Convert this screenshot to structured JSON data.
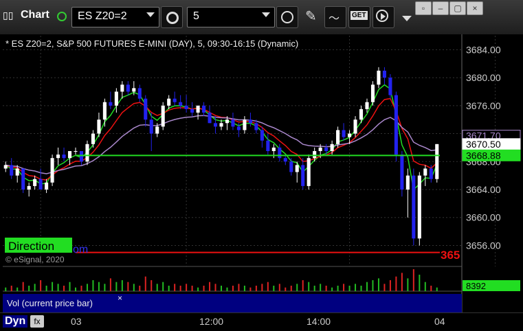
{
  "toolbar": {
    "app_label": "Chart",
    "symbol": "ES Z20=2",
    "interval": "5",
    "get_label": "GET"
  },
  "chart_header": "* ES Z20=2, S&P 500 FUTURES E-MINI (DAY), 5, 09:30-16:15 (Dynamic)",
  "copyright": "© eSignal, 2020",
  "direction_label": "Direction",
  "partial_label_blue": "om",
  "partial_label_red": "365",
  "vol_label": "Vol (current price bar)",
  "vol_close": "×",
  "status": {
    "mode": "Dyn",
    "fx": "fx"
  },
  "colors": {
    "up_candle": "#ffffff",
    "down_candle": "#2222ee",
    "fast_ma": "#22dd22",
    "red_ma": "#ee1111",
    "purple_ma": "#aa88cc",
    "level_green": "#22dd22",
    "level_red": "#ee1111",
    "volume_bar": "#2222aa"
  },
  "chart_data": {
    "type": "candlestick",
    "title": "ES Z20=2, S&P 500 FUTURES E-MINI (DAY), 5, 09:30-16:15 (Dynamic)",
    "ylim": [
      3653,
      3686
    ],
    "y_ticks": [
      "3684.00",
      "3680.00",
      "3676.00",
      "3672.00",
      "3668.00",
      "3664.00",
      "3660.00",
      "3656.00"
    ],
    "x_ticks": [
      {
        "bar": 6,
        "label": "03"
      },
      {
        "bar": 31,
        "label": "12:00"
      },
      {
        "bar": 59,
        "label": "14:00"
      },
      {
        "bar": 84,
        "label": "04"
      }
    ],
    "price_tags": [
      {
        "value": 3671.7,
        "label": "3671.70",
        "style": "purple"
      },
      {
        "value": 3670.5,
        "label": "3670.50",
        "style": "white"
      },
      {
        "value": 3668.88,
        "label": "3668.88",
        "style": "green"
      }
    ],
    "levels": [
      {
        "name": "Direction",
        "value": 3668.88,
        "color": "green"
      },
      {
        "name": "red-level",
        "value": 3655,
        "color": "red"
      }
    ],
    "candles": [
      [
        3667.0,
        3668.0,
        3666.5,
        3667.5
      ],
      [
        3667.5,
        3668.5,
        3665.5,
        3666.0
      ],
      [
        3666.0,
        3667.5,
        3665.0,
        3667.0
      ],
      [
        3667.0,
        3667.0,
        3663.5,
        3664.0
      ],
      [
        3664.0,
        3665.0,
        3663.0,
        3664.5
      ],
      [
        3664.5,
        3666.0,
        3664.0,
        3665.5
      ],
      [
        3665.5,
        3667.0,
        3664.0,
        3664.0
      ],
      [
        3664.0,
        3665.5,
        3663.5,
        3665.0
      ],
      [
        3665.0,
        3669.0,
        3664.5,
        3668.5
      ],
      [
        3668.5,
        3670.0,
        3667.5,
        3669.0
      ],
      [
        3669.0,
        3670.0,
        3668.0,
        3668.5
      ],
      [
        3668.5,
        3669.5,
        3667.5,
        3669.5
      ],
      [
        3669.5,
        3670.0,
        3669.0,
        3669.5
      ],
      [
        3669.5,
        3669.5,
        3667.5,
        3668.0
      ],
      [
        3668.0,
        3671.0,
        3667.5,
        3670.5
      ],
      [
        3670.5,
        3672.5,
        3670.0,
        3672.0
      ],
      [
        3672.0,
        3675.0,
        3671.5,
        3674.0
      ],
      [
        3674.0,
        3677.0,
        3673.0,
        3676.5
      ],
      [
        3676.5,
        3678.0,
        3675.5,
        3676.0
      ],
      [
        3676.0,
        3678.5,
        3675.0,
        3678.0
      ],
      [
        3678.0,
        3679.5,
        3677.0,
        3679.0
      ],
      [
        3679.0,
        3679.5,
        3677.5,
        3678.0
      ],
      [
        3678.0,
        3679.5,
        3677.5,
        3678.5
      ],
      [
        3678.5,
        3679.0,
        3676.5,
        3677.0
      ],
      [
        3677.0,
        3677.5,
        3673.0,
        3674.0
      ],
      [
        3674.0,
        3675.0,
        3669.5,
        3672.0
      ],
      [
        3672.0,
        3673.5,
        3671.5,
        3673.0
      ],
      [
        3673.0,
        3676.5,
        3672.5,
        3676.0
      ],
      [
        3676.0,
        3677.5,
        3675.5,
        3677.0
      ],
      [
        3677.0,
        3678.0,
        3676.0,
        3676.5
      ],
      [
        3676.5,
        3677.5,
        3675.5,
        3676.0
      ],
      [
        3676.0,
        3677.5,
        3675.0,
        3675.5
      ],
      [
        3675.5,
        3676.5,
        3674.5,
        3675.0
      ],
      [
        3675.0,
        3676.0,
        3674.0,
        3676.0
      ],
      [
        3676.0,
        3676.5,
        3674.5,
        3675.0
      ],
      [
        3675.0,
        3676.0,
        3673.5,
        3673.5
      ],
      [
        3673.5,
        3674.5,
        3672.0,
        3673.0
      ],
      [
        3673.0,
        3674.0,
        3672.5,
        3673.5
      ],
      [
        3673.5,
        3674.5,
        3672.5,
        3674.0
      ],
      [
        3674.0,
        3675.0,
        3672.5,
        3673.0
      ],
      [
        3673.0,
        3673.5,
        3671.5,
        3672.5
      ],
      [
        3672.5,
        3674.5,
        3672.0,
        3674.0
      ],
      [
        3674.0,
        3675.0,
        3673.0,
        3673.5
      ],
      [
        3673.5,
        3674.0,
        3672.0,
        3672.5
      ],
      [
        3672.5,
        3673.0,
        3670.0,
        3671.0
      ],
      [
        3671.0,
        3672.0,
        3669.0,
        3669.5
      ],
      [
        3669.5,
        3670.5,
        3668.5,
        3670.0
      ],
      [
        3670.0,
        3670.5,
        3668.0,
        3668.5
      ],
      [
        3668.5,
        3669.0,
        3667.5,
        3668.0
      ],
      [
        3668.0,
        3668.5,
        3666.0,
        3666.5
      ],
      [
        3666.5,
        3668.0,
        3665.0,
        3667.5
      ],
      [
        3667.5,
        3668.5,
        3664.0,
        3664.5
      ],
      [
        3664.5,
        3669.0,
        3664.0,
        3668.5
      ],
      [
        3668.5,
        3670.0,
        3668.0,
        3669.5
      ],
      [
        3669.5,
        3670.5,
        3668.5,
        3670.0
      ],
      [
        3670.0,
        3670.5,
        3669.0,
        3669.5
      ],
      [
        3669.5,
        3671.0,
        3669.0,
        3670.5
      ],
      [
        3670.5,
        3673.0,
        3670.0,
        3672.5
      ],
      [
        3672.5,
        3673.5,
        3671.0,
        3671.5
      ],
      [
        3671.5,
        3672.5,
        3670.5,
        3672.0
      ],
      [
        3672.0,
        3674.5,
        3671.5,
        3674.0
      ],
      [
        3674.0,
        3676.0,
        3673.5,
        3675.5
      ],
      [
        3675.5,
        3677.0,
        3675.0,
        3676.5
      ],
      [
        3676.5,
        3679.5,
        3676.0,
        3679.0
      ],
      [
        3679.0,
        3681.5,
        3678.5,
        3681.0
      ],
      [
        3681.0,
        3681.5,
        3679.0,
        3680.0
      ],
      [
        3680.0,
        3680.5,
        3677.0,
        3677.5
      ],
      [
        3677.5,
        3678.0,
        3668.0,
        3669.0
      ],
      [
        3669.0,
        3669.5,
        3663.0,
        3664.0
      ],
      [
        3664.0,
        3667.0,
        3660.0,
        3666.0
      ],
      [
        3666.0,
        3667.0,
        3656.0,
        3657.0
      ],
      [
        3657.0,
        3666.5,
        3656.0,
        3666.0
      ],
      [
        3666.0,
        3667.5,
        3664.5,
        3667.0
      ],
      [
        3667.0,
        3667.5,
        3665.0,
        3665.5
      ],
      [
        3665.5,
        3670.5,
        3665.0,
        3670.5
      ]
    ],
    "volume": [
      2,
      3,
      2,
      5,
      3,
      4,
      6,
      3,
      5,
      4,
      3,
      5,
      2,
      3,
      4,
      6,
      5,
      4,
      7,
      5,
      6,
      5,
      4,
      3,
      8,
      6,
      4,
      5,
      3,
      4,
      3,
      4,
      3,
      2,
      3,
      5,
      4,
      3,
      2,
      3,
      4,
      3,
      2,
      3,
      4,
      5,
      3,
      4,
      2,
      3,
      4,
      6,
      5,
      3,
      4,
      3,
      2,
      3,
      4,
      3,
      4,
      3,
      5,
      6,
      7,
      4,
      6,
      8,
      10,
      7,
      12,
      9,
      5,
      3,
      2
    ]
  }
}
